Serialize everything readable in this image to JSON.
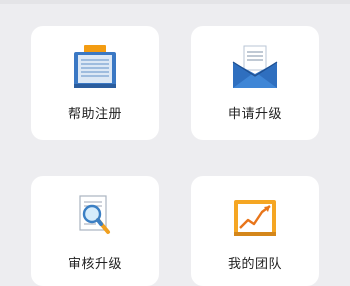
{
  "menu": {
    "items": [
      {
        "label": "帮助注册",
        "icon": "register-book-icon"
      },
      {
        "label": "申请升级",
        "icon": "envelope-icon"
      },
      {
        "label": "审核升级",
        "icon": "magnifier-document-icon"
      },
      {
        "label": "我的团队",
        "icon": "growth-chart-folder-icon"
      }
    ]
  },
  "colors": {
    "page_background": "#ededf0",
    "card_background": "#ffffff",
    "label_text": "#222222"
  }
}
